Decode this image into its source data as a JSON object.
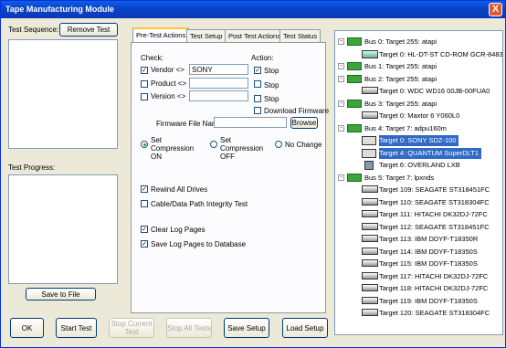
{
  "window": {
    "title": "Tape Manufacturing Module",
    "close_label": "X"
  },
  "left": {
    "test_sequence_label": "Test Sequence:",
    "remove_test_label": "Remove Test",
    "test_progress_label": "Test Progress:",
    "save_to_file_label": "Save to File"
  },
  "tabs": [
    "Pre-Test Actions",
    "Test Setup",
    "Post Test Actions",
    "Test Status"
  ],
  "pretest": {
    "check_label": "Check:",
    "action_label": "Action:",
    "vendor_label": "Vendor <>",
    "vendor_value": "SONY",
    "product_label": "Product <>",
    "product_value": "",
    "version_label": "Version <>",
    "version_value": "",
    "stop_label": "Stop",
    "download_firmware_label": "Download Firmware",
    "firmware_file_label": "Firmware File Name =",
    "firmware_file_value": "",
    "browse_label": "Browse",
    "compression_on_label": "Set Compression ON",
    "compression_off_label": "Set Compression OFF",
    "no_change_label": "No Change",
    "rewind_label": "Rewind All Drives",
    "cable_label": "Cable/Data Path Integrity Test",
    "clear_log_label": "Clear Log Pages",
    "save_log_label": "Save Log Pages to Database"
  },
  "buttons": {
    "ok": "OK",
    "start_test": "Start Test",
    "stop_current": "Stop Current Test",
    "stop_all": "Stop All Tests",
    "save_setup": "Save Setup",
    "load_setup": "Load Setup"
  },
  "tree": [
    {
      "label": "Bus 0: Target 255: atapi",
      "kind": "bus",
      "level": 0,
      "pm": "-"
    },
    {
      "label": "Target 0: HL-DT-ST CD-ROM GCR-8483B",
      "kind": "cd",
      "level": 1
    },
    {
      "label": "Bus 1: Target 255: atapi",
      "kind": "bus",
      "level": 0,
      "pm": "-"
    },
    {
      "label": "Bus 2: Target 255: atapi",
      "kind": "bus",
      "level": 0,
      "pm": "-"
    },
    {
      "label": "Target 0: WDC WD16 00JB-00FUA0",
      "kind": "drv",
      "level": 1
    },
    {
      "label": "Bus 3: Target 255: atapi",
      "kind": "bus",
      "level": 0,
      "pm": "-"
    },
    {
      "label": "Target 0: Maxtor 6 Y060L0",
      "kind": "drv",
      "level": 1
    },
    {
      "label": "Bus 4: Target 7: adpu160m",
      "kind": "bus",
      "level": 0,
      "pm": "-"
    },
    {
      "label": "Target 0: SONY    SDZ-100",
      "kind": "tape",
      "level": 1,
      "selected": true
    },
    {
      "label": "Target 4: QUANTUM  SuperDLT1",
      "kind": "tape",
      "level": 1,
      "selected": true
    },
    {
      "label": "Target 6: OVERLAND LXB",
      "kind": "robot",
      "level": 1
    },
    {
      "label": "Bus 5: Target 7: lpxnds",
      "kind": "bus",
      "level": 0,
      "pm": "-"
    },
    {
      "label": "Target 109: SEAGATE  ST318451FC",
      "kind": "drv",
      "level": 1
    },
    {
      "label": "Target 110: SEAGATE  ST318304FC",
      "kind": "drv",
      "level": 1
    },
    {
      "label": "Target 111: HITACHI  DK32DJ-72FC",
      "kind": "drv",
      "level": 1
    },
    {
      "label": "Target 112: SEAGATE  ST318451FC",
      "kind": "drv",
      "level": 1
    },
    {
      "label": "Target 113: IBM      DDYF-T18350R",
      "kind": "drv",
      "level": 1
    },
    {
      "label": "Target 114: IBM      DDYF-T18350S",
      "kind": "drv",
      "level": 1
    },
    {
      "label": "Target 115: IBM      DDYF-T18350S",
      "kind": "drv",
      "level": 1
    },
    {
      "label": "Target 117: HITACHI  DK32DJ-72FC",
      "kind": "drv",
      "level": 1
    },
    {
      "label": "Target 118: HITACHI  DK32DJ-72FC",
      "kind": "drv",
      "level": 1
    },
    {
      "label": "Target 119: IBM      DDYF-T18350S",
      "kind": "drv",
      "level": 1
    },
    {
      "label": "Target 120: SEAGATE  ST318304FC",
      "kind": "drv",
      "level": 1
    }
  ]
}
